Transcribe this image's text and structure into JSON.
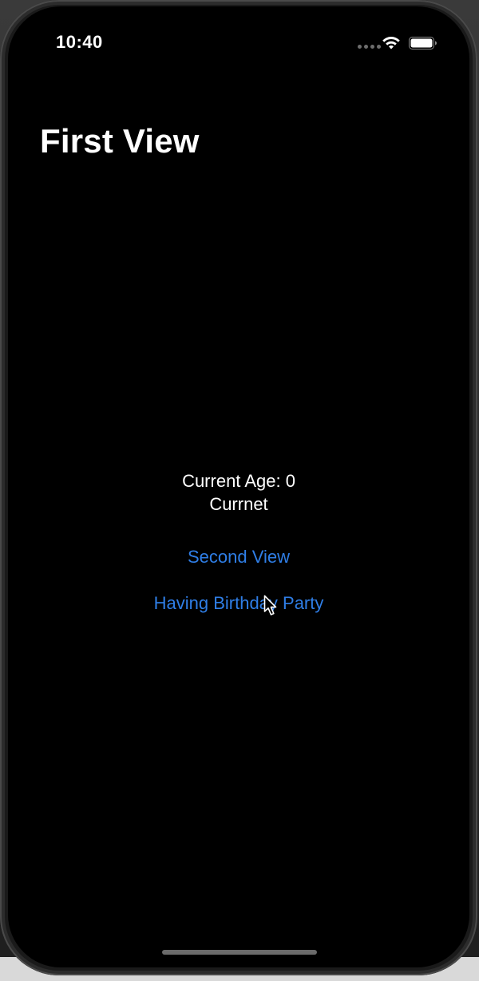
{
  "status_bar": {
    "time": "10:40"
  },
  "nav": {
    "title": "First View"
  },
  "content": {
    "age_text": "Current Age: 0",
    "status_text": "Currnet",
    "second_view_label": "Second View",
    "birthday_label": "Having Birthday Party"
  },
  "colors": {
    "background": "#000000",
    "text": "#ffffff",
    "link": "#2f7ee6"
  },
  "icons": {
    "signal": "signal-dots-icon",
    "wifi": "wifi-icon",
    "battery": "battery-icon",
    "cursor": "mouse-pointer-icon"
  }
}
